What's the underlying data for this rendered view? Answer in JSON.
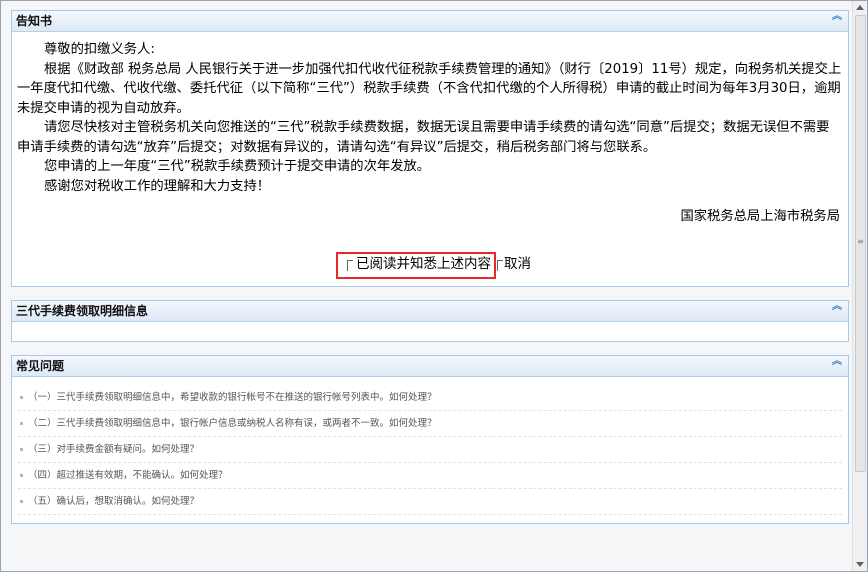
{
  "notice": {
    "title": "告知书",
    "greeting": "尊敬的扣缴义务人:",
    "paragraphs": [
      "根据《财政部 税务总局 人民银行关于进一步加强代扣代收代征税款手续费管理的通知》（财行〔2019〕11号）规定，向税务机关提交上一年度代扣代缴、代收代缴、委托代征（以下简称“三代”）税款手续费（不含代扣代缴的个人所得税）申请的截止时间为每年3月30日，逾期未提交申请的视为自动放弃。",
      "请您尽快核对主管税务机关向您推送的“三代”税款手续费数据，数据无误且需要申请手续费的请勾选“同意”后提交；数据无误但不需要申请手续费的请勾选“放弃”后提交；对数据有异议的，请请勾选“有异议”后提交，稍后税务部门将与您联系。",
      "您申请的上一年度“三代”税款手续费预计于提交申请的次年发放。",
      "感谢您对税收工作的理解和大力支持！"
    ],
    "signature": "国家税务总局上海市税务局",
    "confirm_label": "已阅读并知悉上述内容",
    "cancel_label": "取消"
  },
  "fee_panel": {
    "title": "三代手续费领取明细信息"
  },
  "faq": {
    "title": "常见问题",
    "items": [
      "（一）三代手续费领取明细信息中，希望收款的银行帐号不在推送的银行帐号列表中。如何处理？",
      "（二）三代手续费领取明细信息中，银行帐户信息或纳税人名称有误，或两者不一致。如何处理？",
      "（三）对手续费金额有疑问。如何处理？",
      "（四）超过推送有效期，不能确认。如何处理？",
      "（五）确认后，想取消确认。如何处理？"
    ]
  },
  "icons": {
    "collapse": "chevron-double-up-icon"
  },
  "colors": {
    "highlight_border": "#e52a2a",
    "panel_border": "#a9c7e6"
  }
}
